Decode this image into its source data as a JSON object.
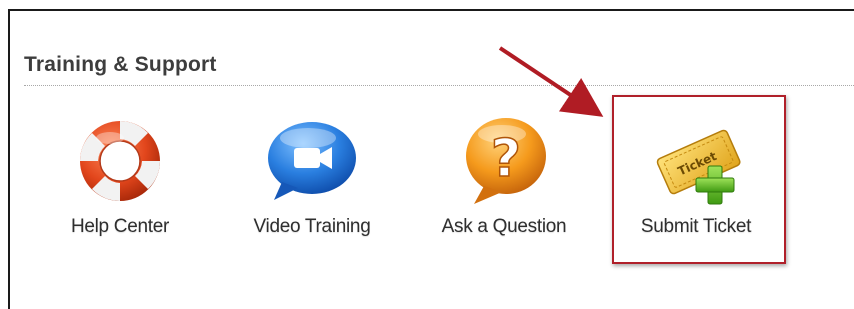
{
  "section": {
    "title": "Training & Support"
  },
  "items": [
    {
      "label": "Help Center",
      "icon": "life-ring-icon"
    },
    {
      "label": "Video Training",
      "icon": "video-chat-icon"
    },
    {
      "label": "Ask a Question",
      "icon": "question-bubble-icon"
    },
    {
      "label": "Submit Ticket",
      "icon": "ticket-add-icon",
      "ticket_text": "Ticket"
    }
  ],
  "colors": {
    "highlight_border": "#b0202a",
    "arrow": "#b01c24",
    "title_text": "#3d3d3d",
    "label_text": "#2e2e2e"
  }
}
